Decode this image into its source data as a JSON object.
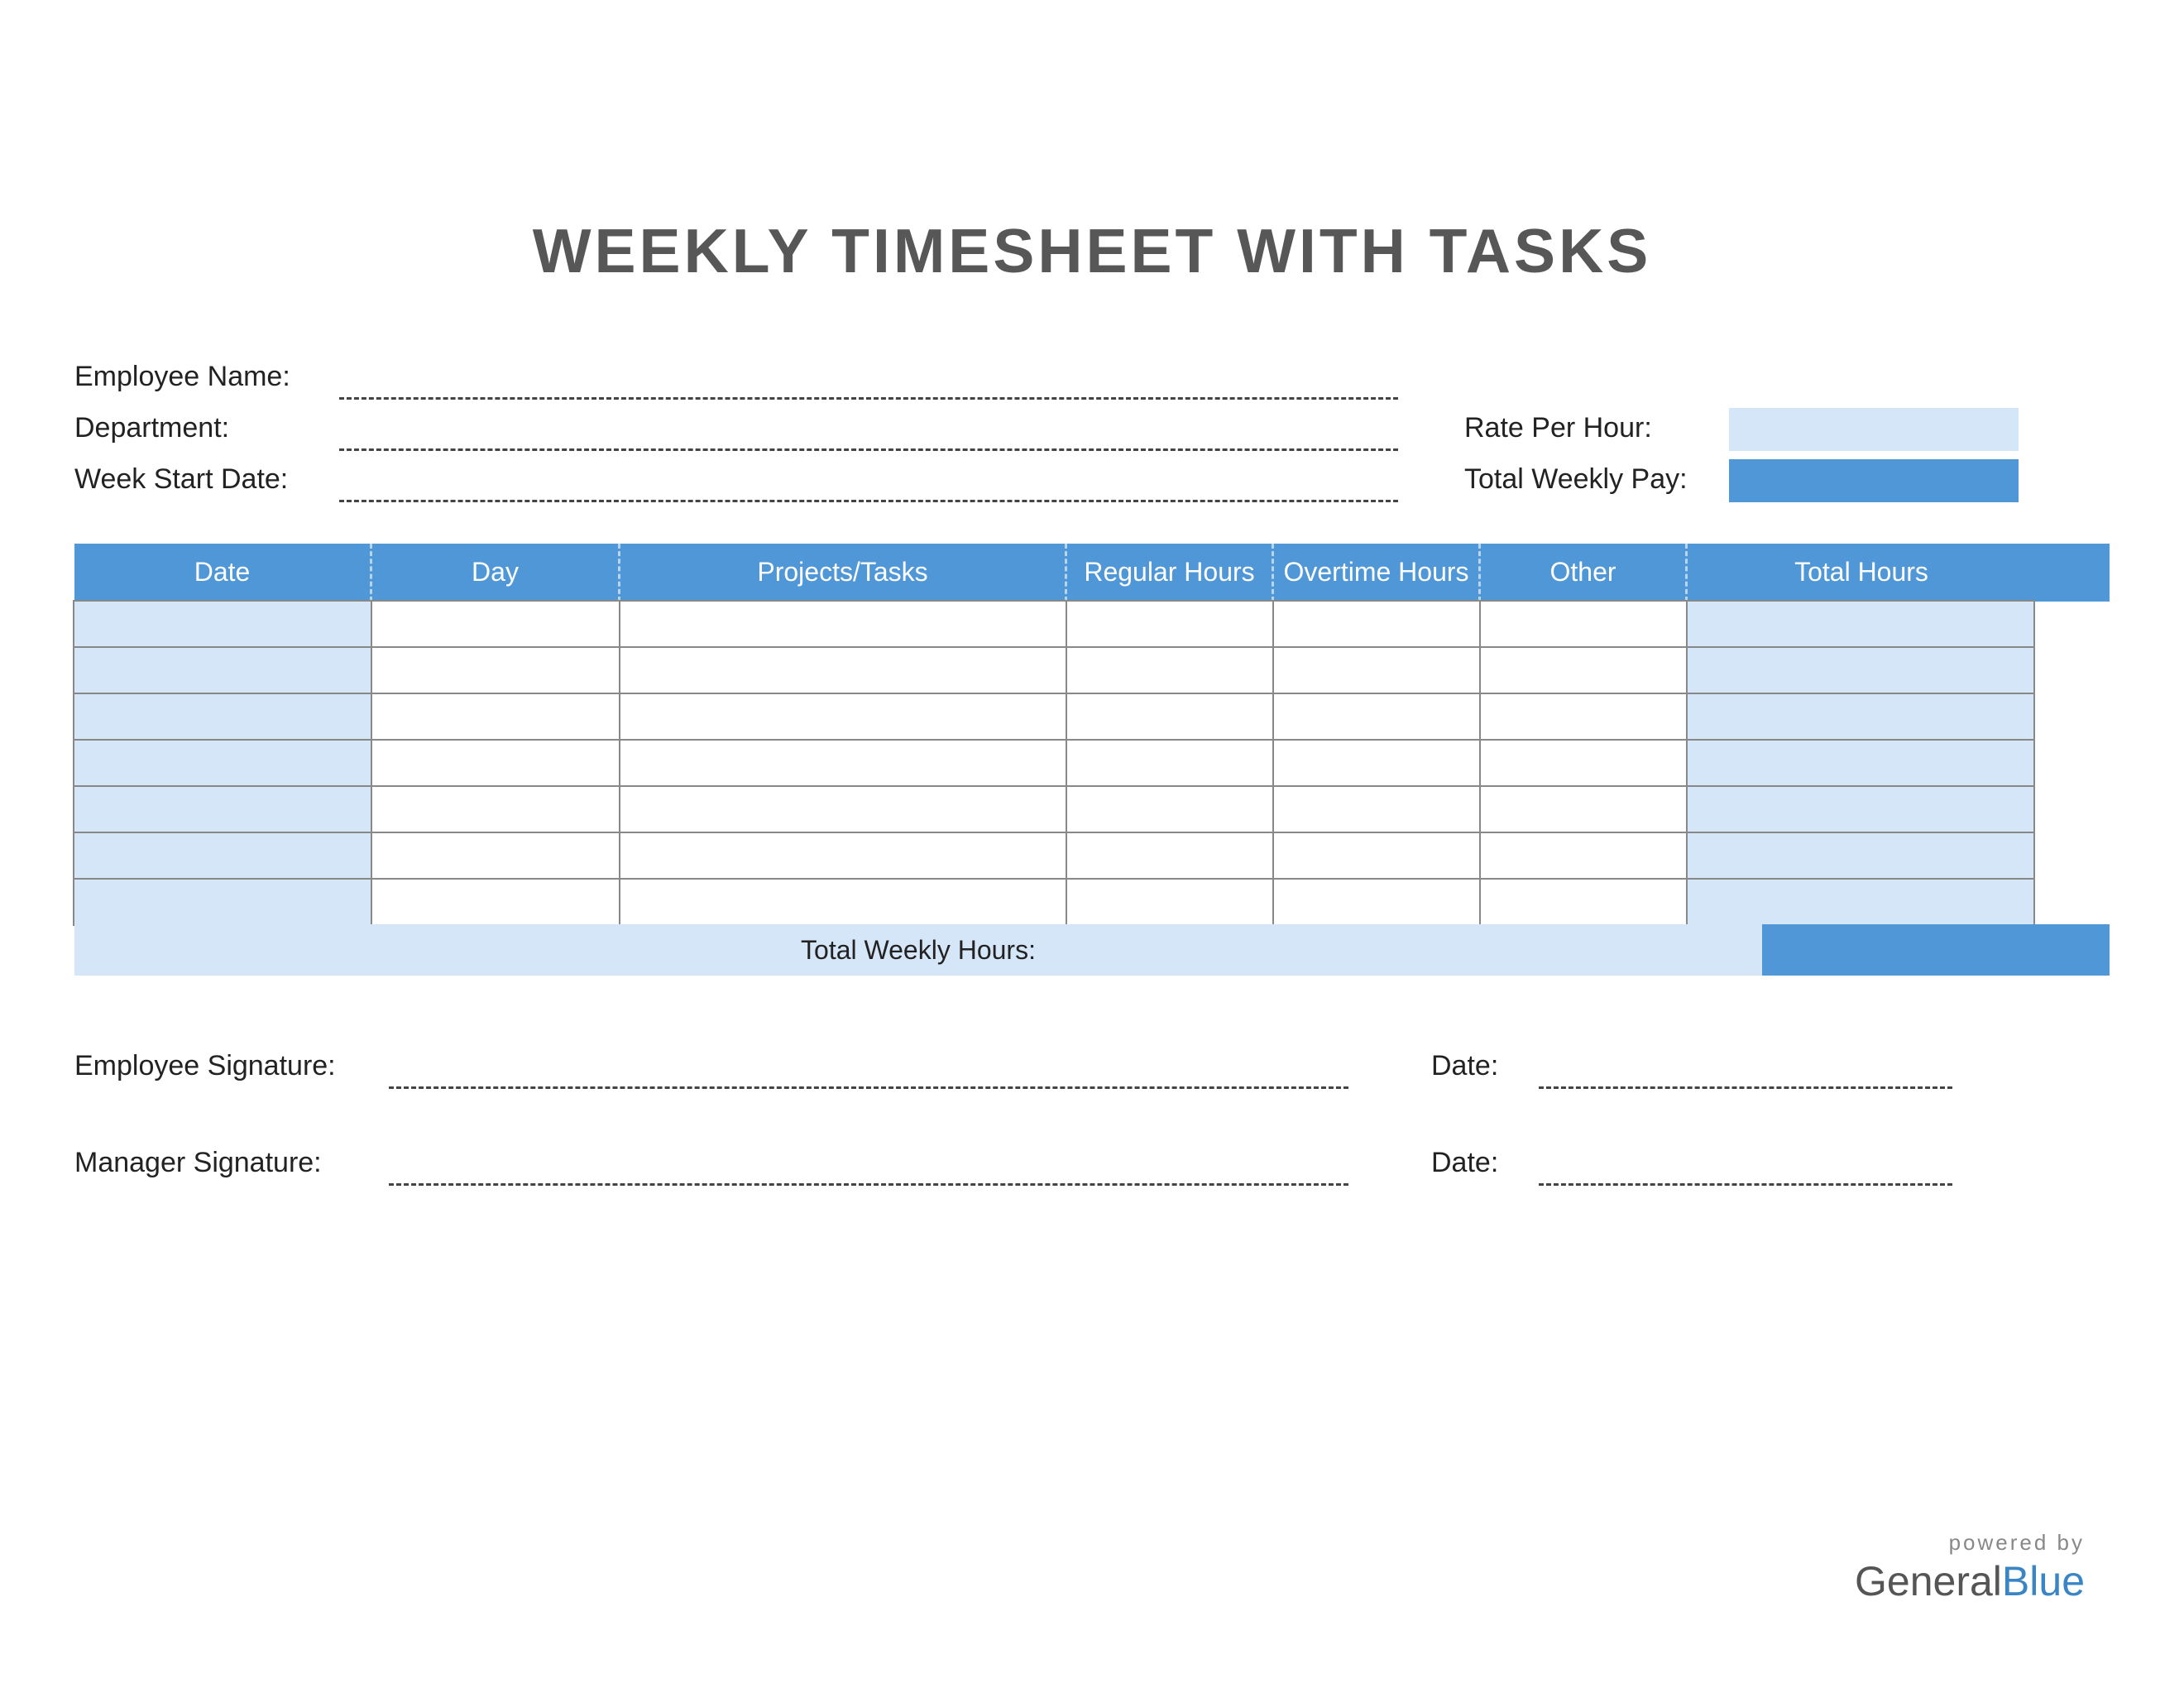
{
  "title": "WEEKLY TIMESHEET WITH TASKS",
  "fields": {
    "employee_name_label": "Employee Name:",
    "department_label": "Department:",
    "week_start_label": "Week Start Date:",
    "rate_label": "Rate Per Hour:",
    "total_pay_label": "Total Weekly Pay:",
    "employee_name": "",
    "department": "",
    "week_start": "",
    "rate_per_hour": "",
    "total_weekly_pay": ""
  },
  "table": {
    "headers": {
      "date": "Date",
      "day": "Day",
      "projects": "Projects/Tasks",
      "regular": "Regular Hours",
      "overtime": "Overtime Hours",
      "other": "Other",
      "total": "Total Hours"
    },
    "rows": [
      {
        "date": "",
        "day": "",
        "projects": "",
        "regular": "",
        "overtime": "",
        "other": "",
        "total": ""
      },
      {
        "date": "",
        "day": "",
        "projects": "",
        "regular": "",
        "overtime": "",
        "other": "",
        "total": ""
      },
      {
        "date": "",
        "day": "",
        "projects": "",
        "regular": "",
        "overtime": "",
        "other": "",
        "total": ""
      },
      {
        "date": "",
        "day": "",
        "projects": "",
        "regular": "",
        "overtime": "",
        "other": "",
        "total": ""
      },
      {
        "date": "",
        "day": "",
        "projects": "",
        "regular": "",
        "overtime": "",
        "other": "",
        "total": ""
      },
      {
        "date": "",
        "day": "",
        "projects": "",
        "regular": "",
        "overtime": "",
        "other": "",
        "total": ""
      },
      {
        "date": "",
        "day": "",
        "projects": "",
        "regular": "",
        "overtime": "",
        "other": "",
        "total": ""
      }
    ],
    "total_label": "Total Weekly Hours:",
    "total_value": ""
  },
  "signatures": {
    "employee_label": "Employee Signature:",
    "manager_label": "Manager Signature:",
    "date_label": "Date:",
    "employee_signature": "",
    "employee_date": "",
    "manager_signature": "",
    "manager_date": ""
  },
  "footer": {
    "powered": "powered by",
    "brand_a": "General",
    "brand_b": "Blue"
  }
}
